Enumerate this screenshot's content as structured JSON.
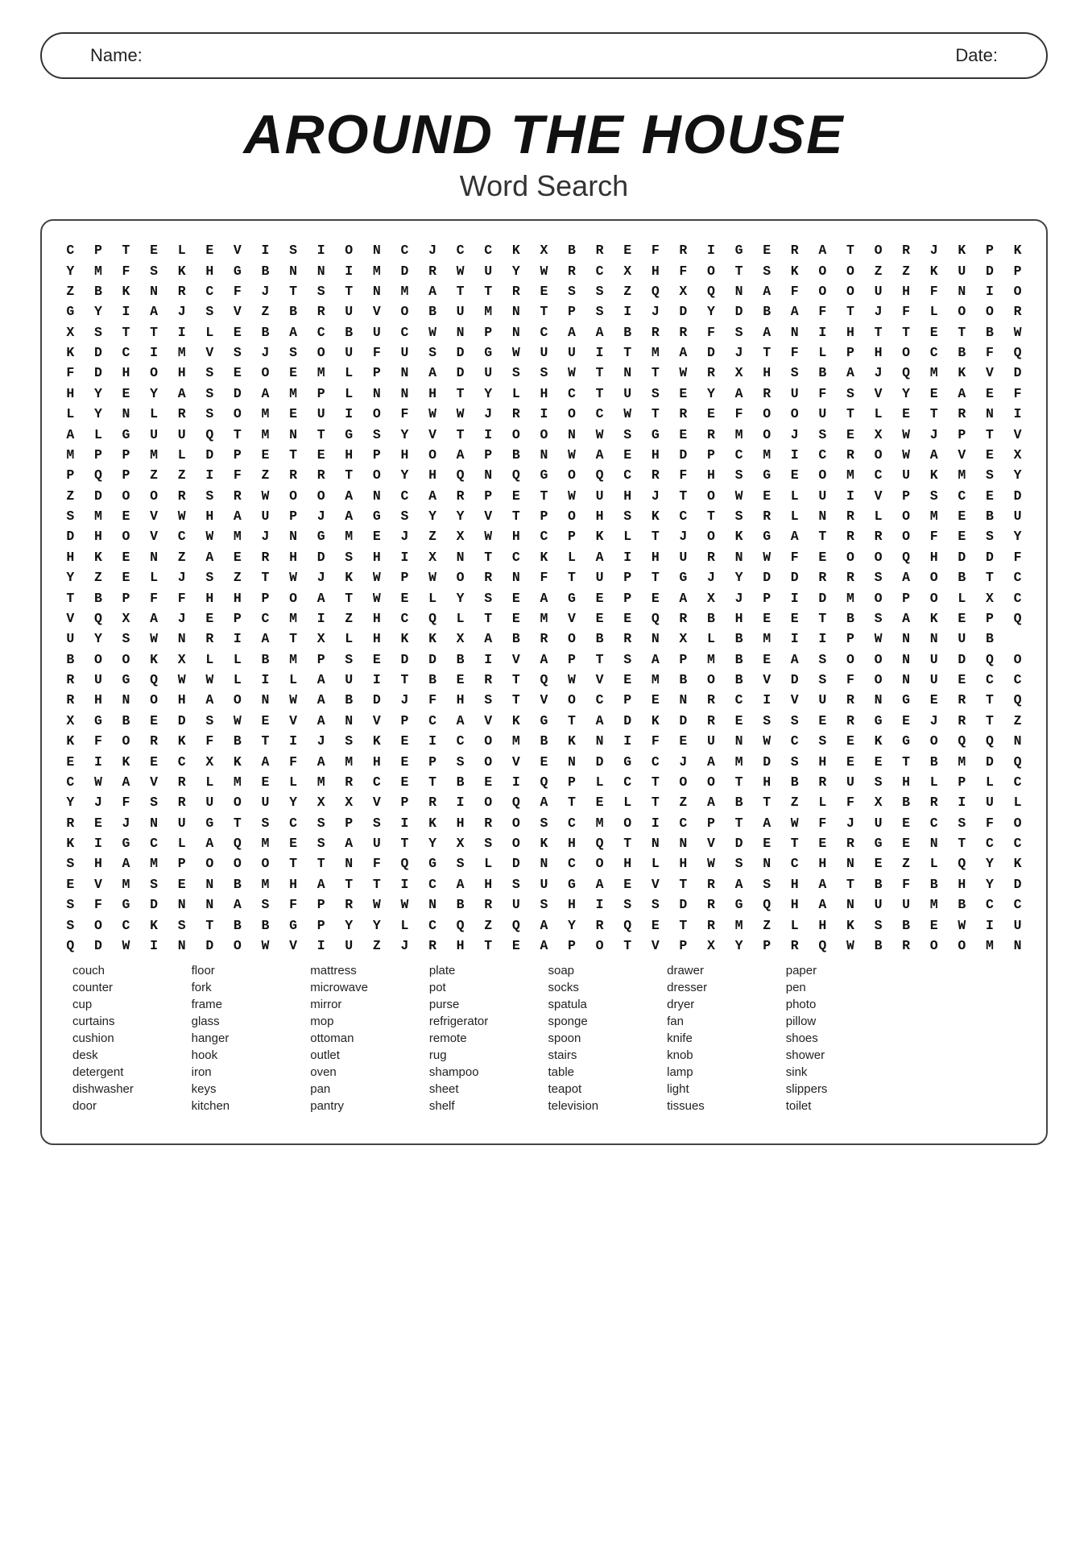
{
  "header": {
    "name_label": "Name:",
    "date_label": "Date:"
  },
  "title": {
    "main": "Around The House",
    "subtitle": "Word Search"
  },
  "grid": [
    "CPTELEVISIO NCJCCKXBREFRIGERATORJKPK",
    "YMFSKHGBNNI MDRWUYWRCXHFOTSKOOЗZKUDP",
    "ZBKNRCFJTST NMATTRESSZQXQNAFOOUНFNIO",
    "GYIAJSVZBRU VOBUMNTPSIJDYDBAFTJFLOOR",
    "XSTTILEBAСB UCWNPNCAABRRFSANIHTTЕTBW",
    "KDCIMVSJSOU FUSDGWUUITMАDJTFLPHOCBFQ",
    "FDHOHSEOÉML PNADUSSWTNTWRXHSBAJQMKVD",
    "HYEYASDAMPL NNHTYIНCTUSEЯARUFSΝYEAEF",
    "LYNLRSOMЕUI OFWWJRIOCWTREFOOUTLETRNI",
    "ALGŪUQTMNTG SYVTIOONWSGERMOJSEXWJPTV",
    "MPPMLDPETEH PHOAPBNWAÉHDPCMICROWAVEX",
    "PQPZZIFZRRT OYHQNQGOQCRFHSGEOMCUKMSУ",
    "ZDOORSRWOOA NCARPETWUHJTOWELUIVPSCED",
    "SMEVWHAUPJA GSYYVTPOHSKCTŜRLNRLOMEBU",
    "DHOVCWMJNGM EJZXWHCPKLTJOKGATRROFESY",
    "HKENZAERHDS HIXNTCKLÀIHURNWFEOOQHDDف",
    "YZELJSZTWJK WPWORNFTUPTGJYDDРRSAOBTC",
    "TBPFFHHPOАT WELYSEAГEPEAXJPIDMOPOLXC",
    "VQXAJEPCMIZ HCQLTEMVEEQRBHEETBSAKEPQ",
    "UYSWNRIATXL HKKXABROB RNXLBMIIPWNNUB",
    "BOOKXLLBMPS EDDBIVAРTSAMBEASONUDQO",
    "RUGQWWLILAУ ITBERTQWVEMBOBVDSFONUECС",
    "RHNОHAONWAB DJFHSTVOCPENRCIVURNGERTQ",
    "XGBEDSWEVAN VPCAVKGTADKDRESSERGEIRTZ",
    "KFORKFBTIJS KEICOMBKNIFEUNWCSEKGOQQN",
    "EIKECXKAFAM HEPSOVËNDGCJАМDSHEETBMDQ",
    "CWAVRLMELMR CETBEIQPLCTOOTHBRUSHLPLC",
    "YJFSRUOUYXX VPRIOQATELTZABTZLFXBRIUL",
    "REJNUGTSCSP SIKHROSСMOICPTAWFJUECSFO",
    "KIGCLAQMEŜA UTYXSOKНQTNNVDЕTERGENTCC",
    "SHAMPOOÖTTN FQGSLDNCOHLHWSNCHNE ZLQYK",
    "EVMSENBMHAT TICAHSUGAEVTRASHATBFBHYD",
    "SFGDNNASFPR WWNBRUSHISSDRGQHANUUMBC С",
    "SOCКSTBBGPY YLCQZQAYRQETRMZLHKSBEWIU",
    "QDWINDOWVIU ZJRHTEAPOTVPXYPРQWBROOMN"
  ],
  "grid_rows": [
    "C P T E L E V I S I O N C J C C K X B R E F R I G E R A T O R J K P K",
    "Y M F S K H G B N N I M D R W U Y W R C X H F O T S K O O Z Z K U D P",
    "Z B K N R C F J T S T N M A T T R E S S Z Q X Q N A F O O U H F N I O",
    "G Y I A J S V Z B R U V O B U M N T P S I J D Y D B A F T J F L O O R",
    "X S T T I L E B A C B U C W N P N C A A B R R F S A N I H T T E T B W",
    "K D C I M V S J S O U F U S D G W U U I T M A D J T F L P H O C B F Q",
    "F D H O H S E O E M L P N A D U S S W T N T W R X H S B A J Q M K V D",
    "H Y E Y A S D A M P L N N H T Y L H C T U S E Y A R U F S V Y E A E F",
    "L Y N L R S O M E U I O F W W J R I O C W T R E F O O U T L E T R N I",
    "A L G U U Q T M N T G S Y V T I O O N W S G E R M O J S E X W J P T V",
    "M P P M L D P E T E H P H O A P B N W A E H D P C M I C R O W A V E X",
    "P Q P Z Z I F Z R R T O Y H Q N Q G O Q C R F H S G E O M C U K M S Y",
    "Z D O O R S R W O O A N C A R P E T W U H J T O W E L U I V P S C E D",
    "S M E V W H A U P J A G S Y Y V T P O H S K C T S R L N R L O M E B U",
    "D H O V C W M J N G M E J Z X W H C P K L T J O K G A T R R O F E S Y",
    "H K E N Z A E R H D S H I X N T C K L A I H U R N W F E O O Q H D D F",
    "Y Z E L J S Z T W J K W P W O R N F T U P T G J Y D D R R S A O B T C",
    "T B P F F H H P O A T W E L Y S E A G E P E A X J P I D M O P O L X C",
    "V Q X A J E P C M I Z H C Q L T E M V E E Q R B H E E T B S A K E P Q",
    "U Y S W N R I A T X L H K K X A B R O B R N X L B M I I P W N N U B",
    "B O O K X L L B M P S E D D B I V A P T S A P M B E A S O O N U D Q O",
    "R U G Q W W L I L A U I T B E R T Q W V E M B O B V D S F O N U E C C",
    "R H N O H A O N W A B D J F H S T V O C P E N R C I V U R N G E R T Q",
    "X G B E D S W E V A N V P C A V K G T A D K D R E S S E R G E J R T Z",
    "K F O R K F B T I J S K E I C O M B K N I F E U N W C S E K G O Q Q N",
    "E I K E C X K A F A M H E P S O V E N D G C J A M D S H E E T B M D Q",
    "C W A V R L M E L M R C E T B E I Q P L C T O O T H B R U S H L P L C",
    "Y J F S R U O U Y X X V P R I O Q A T E L T Z A B T Z L F X B R I U L",
    "R E J N U G T S C S P S I K H R O S C M O I C P T A W F J U E C S F O",
    "K I G C L A Q M E S A U T Y X S O K H Q T N N V D E T E R G E N T C C",
    "S H A M P O O O T T N F Q G S L D N C O H L H W S N C H N E Z L Q Y K",
    "E V M S E N B M H A T T I C A H S U G A E V T R A S H A T B F B H Y D",
    "S F G D N N A S F P R W W N B R U S H I S S D R G Q H A N U U M B C C",
    "S O C K S T B B G P Y Y L C Q Z Q A Y R Q E T R M Z L H K S B E W I U",
    "Q D W I N D O W V I U Z J R H T E A P O T V P X Y P R Q W B R O O M N"
  ],
  "word_columns": [
    {
      "words": [
        "couch",
        "counter",
        "cup",
        "curtains",
        "cushion",
        "desk",
        "detergent",
        "dishwasher",
        "door"
      ]
    },
    {
      "words": [
        "floor",
        "fork",
        "frame",
        "glass",
        "hanger",
        "hook",
        "iron",
        "keys",
        "kitchen"
      ]
    },
    {
      "words": [
        "mattress",
        "microwave",
        "mirror",
        "mop",
        "ottoman",
        "outlet",
        "oven",
        "pan",
        "pantry"
      ]
    },
    {
      "words": [
        "plate",
        "pot",
        "purse",
        "refrigerator",
        "remote",
        "rug",
        "shampoo",
        "sheet",
        "shelf"
      ]
    },
    {
      "words": [
        "soap",
        "socks",
        "spatula",
        "sponge",
        "spoon",
        "stairs",
        "table",
        "teapot",
        "television"
      ]
    },
    {
      "words": [
        "drawer",
        "dresser",
        "dryer",
        "fan",
        "knife",
        "knob",
        "lamp",
        "light",
        "tissues"
      ]
    },
    {
      "words": [
        "paper",
        "pen",
        "photo",
        "pillow",
        "shoes",
        "shower",
        "sink",
        "slippers",
        "toilet"
      ]
    }
  ]
}
